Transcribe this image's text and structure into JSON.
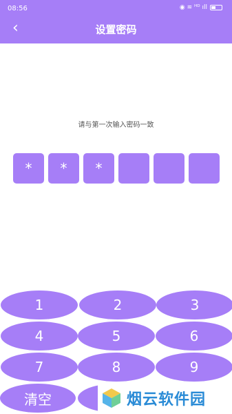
{
  "status_bar": {
    "time": "08:56",
    "icons": "◉ ≋ ᴴᴰ ıll"
  },
  "header": {
    "title": "设置密码",
    "back_icon": "‹"
  },
  "hint": "请与第一次输入密码一致",
  "pin": [
    "*",
    "*",
    "*",
    "",
    "",
    ""
  ],
  "keypad": {
    "k1": "1",
    "k2": "2",
    "k3": "3",
    "k4": "4",
    "k5": "5",
    "k6": "6",
    "k7": "7",
    "k8": "8",
    "k9": "9",
    "clear": "清空"
  },
  "watermark": "烟云软件园",
  "colors": {
    "accent": "#a67ef7"
  }
}
